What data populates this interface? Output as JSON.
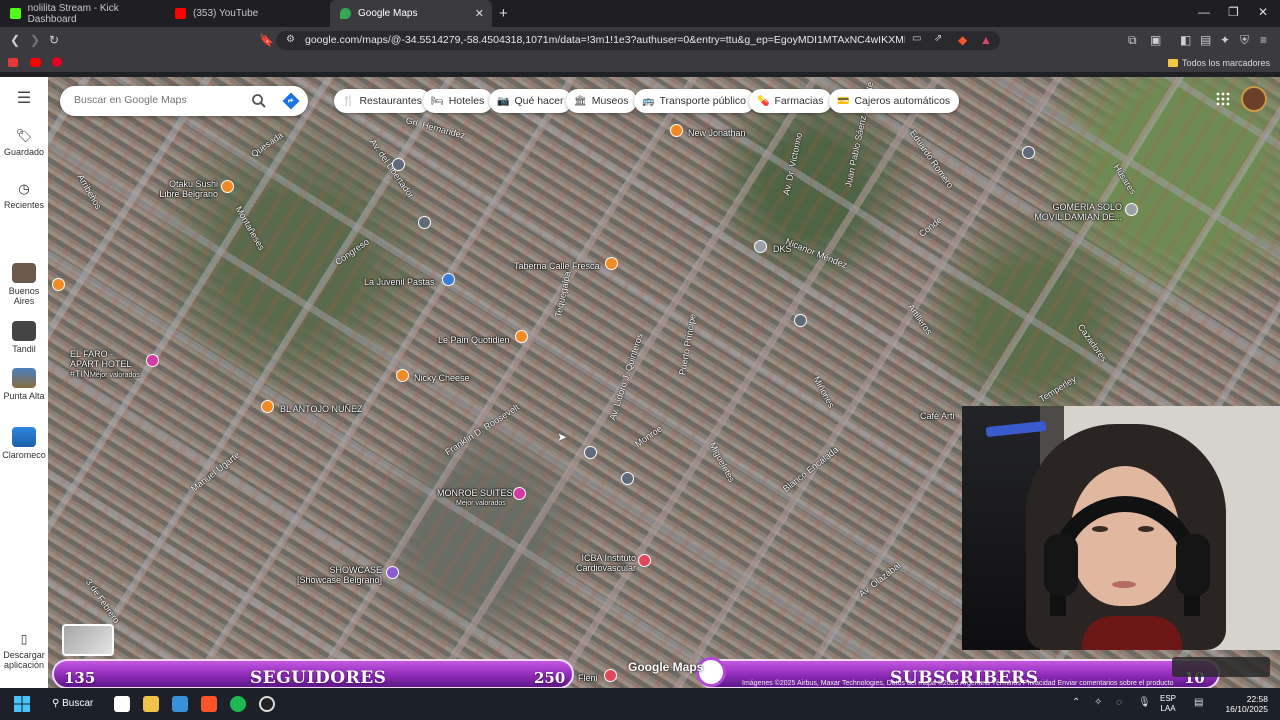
{
  "browser": {
    "tabs": [
      {
        "label": "nolilita Stream - Kick Dashboard",
        "color": "#53fc18"
      },
      {
        "label": "(353) YouTube",
        "color": "#ff0000"
      },
      {
        "label": "Google Maps",
        "color": "#34a853"
      }
    ],
    "url": "google.com/maps/@-34.5514279,-58.4504318,1071m/data=!3m1!1e3?authuser=0&entry=ttu&g_ep=EgoyMDI1MTAxNC4wIKXMDSoASAFQAw...",
    "bookmarks_all": "Todos los marcadores"
  },
  "maps": {
    "rail": [
      {
        "label": "Guardado"
      },
      {
        "label": "Recientes"
      },
      {
        "label": "Buenos Aires"
      },
      {
        "label": "Tandil"
      },
      {
        "label": "Punta Alta"
      },
      {
        "label": "Claromeco"
      },
      {
        "label": "Descargar aplicación"
      }
    ],
    "search_placeholder": "Buscar en Google Maps",
    "chips": [
      "Restaurantes",
      "Hoteles",
      "Qué hacer",
      "Museos",
      "Transporte público",
      "Farmacias",
      "Cajeros automáticos"
    ],
    "places": [
      "New Jonathan",
      "Otaku Sushi Libre Belgrano",
      "La Juvenil Pastas",
      "Taberna Calle Fresca",
      "DKS",
      "GOMERIA SOLO MOVIL DAMIAN DE...",
      "Le Pain Quotidien",
      "Nicky Cheese",
      "EL FARO - APART HOTEL #TINI #...",
      "Mejor valorados",
      "BL ANTOJO NUÑEZ",
      "MONROE SUITES",
      "Mejor valorados",
      "ICBA Instituto Cardiovascular",
      "SHOWCASE [Showcase Belgrano]",
      "Café Arti",
      "Fleni"
    ],
    "streets": [
      "Av. del Libertador",
      "Congreso",
      "Quesada",
      "Montañeses",
      "Arribeños",
      "Franklin D. Roosevelt",
      "Manuel Ugarte",
      "3 de Febrero",
      "Monroe",
      "Av. Lidoro J. Quinteros",
      "Puerto Príncipe",
      "Nicanor Méndez",
      "Blanco Encalada",
      "Miñones",
      "Migueletes",
      "Av. Olazábal",
      "Cazadores",
      "Húsares",
      "Eduardo Romero",
      "Juan Pablo Sáenz Valiente",
      "Conde",
      "Artilleros",
      "Tequegalpa",
      "Grl. Hernandez",
      "Av. Dr. Victorino",
      "Superí",
      "Moldes",
      "Estomba",
      "Temperley",
      "Vidal"
    ],
    "watermark": "Google Maps",
    "attribution": "Imágenes ©2025 Airbus, Maxar Technologies, Datos del mapa ©2025  Argentina  Términos  Privacidad  Enviar comentarios sobre el producto"
  },
  "overlay": {
    "left_count": "135",
    "left_label": "SEGUIDORES",
    "left_goal": "250",
    "right_count": "0",
    "right_label": "SUBSCRIBERS",
    "right_goal": "10"
  },
  "taskbar": {
    "search_label": "Buscar",
    "lang_line1": "ESP",
    "lang_line2": "LAA",
    "time": "22:58",
    "date": "16/10/2025"
  }
}
